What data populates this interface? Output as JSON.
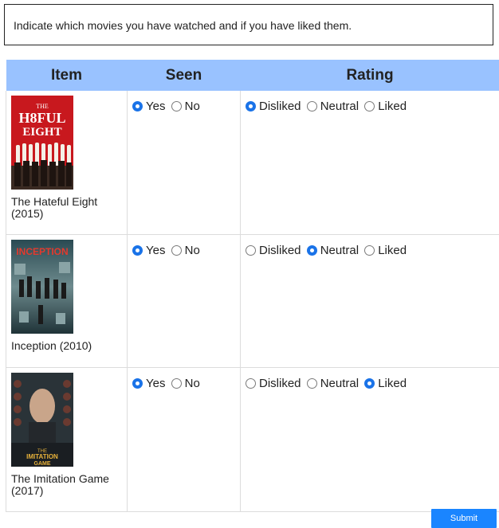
{
  "instructions": "Indicate which movies you have watched and if you have liked them.",
  "headers": {
    "item": "Item",
    "seen": "Seen",
    "rating": "Rating"
  },
  "seen_options": [
    "Yes",
    "No"
  ],
  "rating_options": [
    "Disliked",
    "Neutral",
    "Liked"
  ],
  "movies": [
    {
      "title": "The Hateful Eight (2015)",
      "seen": "Yes",
      "rating": "Disliked",
      "poster_text": "THE H8TEFUL EIGHT"
    },
    {
      "title": "Inception (2010)",
      "seen": "Yes",
      "rating": "Neutral",
      "poster_text": "INCEPTION"
    },
    {
      "title": "The Imitation Game (2017)",
      "seen": "Yes",
      "rating": "Liked",
      "poster_text": "THE IMITATION GAME"
    }
  ],
  "submit_label": "Submit",
  "colors": {
    "header_bg": "#99c2ff",
    "accent": "#1a73e8",
    "submit_bg": "#1a85ff"
  }
}
